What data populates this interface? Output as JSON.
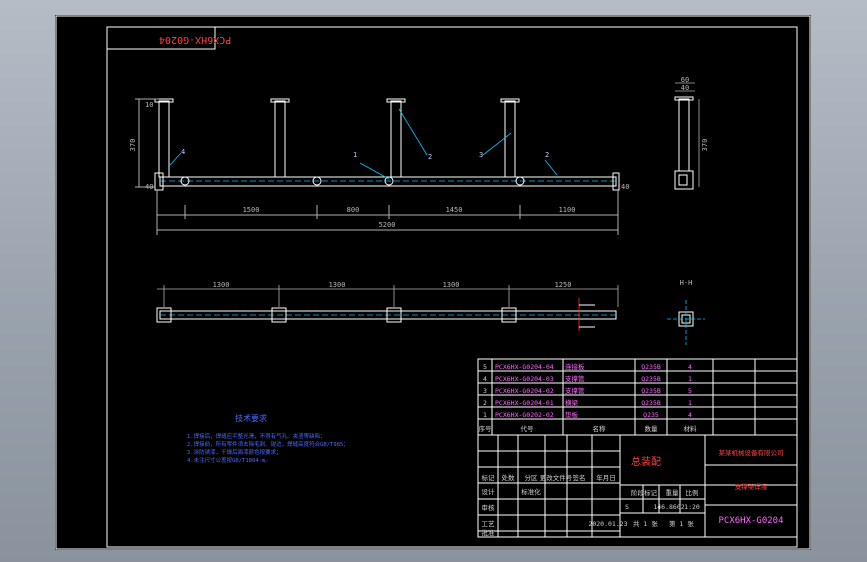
{
  "drawing": {
    "corner_label": "PCX6HX-G0204",
    "elevation": {
      "dims_bottom": [
        "1500",
        "800",
        "1450",
        "1100"
      ],
      "overall": "5200",
      "height": "370",
      "left_small": "40",
      "right_small": "40",
      "top_small": "10",
      "callouts": [
        "4",
        "1",
        "2",
        "3",
        "2"
      ]
    },
    "side_view": {
      "dims_top": [
        "60",
        "40"
      ],
      "dims_side": [
        "370"
      ]
    },
    "plan": {
      "dims_top": [
        "1300",
        "1300",
        "1300",
        "1250"
      ],
      "section_label": "H-H"
    },
    "notes": {
      "heading": "技术要求",
      "lines": [
        "1.焊接后，焊缝应平整光滑，不得有气孔、夹渣等缺陷；",
        "2.焊接前，所有零件须去除毛刺、锐边，焊缝高度符合GB/T985；",
        "3.涂防锈漆，干燥后面漆颜色按要求；",
        "4.未注尺寸公差按GB/T1804-m。"
      ]
    },
    "bom": {
      "rows": [
        {
          "no": "5",
          "code": "PCX6HX-G0204-04",
          "name": "连接板",
          "material": "Q235B",
          "qty": "4"
        },
        {
          "no": "4",
          "code": "PCX6HX-G0204-03",
          "name": "支撑管",
          "material": "Q235B",
          "qty": "1"
        },
        {
          "no": "3",
          "code": "PCX6HX-G0204-02",
          "name": "支撑管",
          "material": "Q235B",
          "qty": "5"
        },
        {
          "no": "2",
          "code": "PCX6HX-G0204-01",
          "name": "横梁",
          "material": "Q235B",
          "qty": "1"
        },
        {
          "no": "1",
          "code": "PCX6HX-G0202-02",
          "name": "垫板",
          "material": "Q235",
          "qty": "4"
        }
      ],
      "header": {
        "no": "序号",
        "code": "代号",
        "name": "名称",
        "material": "材料",
        "qty": "数量"
      }
    },
    "title_block": {
      "company": "某某机械设备有限公司",
      "drawing_title": "支撑架焊接",
      "drawing_number": "PCX6HX-G0204",
      "stage_label": "阶段标记",
      "weight_label": "重量",
      "scale_label": "比例",
      "weight": "146.8602",
      "scale": "1:20",
      "stage": "S",
      "sheet": "共 1 张",
      "sheet2": "第 1 张",
      "date": "2020.01.23",
      "rows": [
        "标记",
        "处数",
        "分区",
        "更改文件号",
        "签名",
        "年月日"
      ],
      "roles": [
        "设计",
        "审核",
        "工艺",
        "批准"
      ],
      "std": "标准化",
      "designer": "",
      "red_mark": "总装配"
    }
  }
}
